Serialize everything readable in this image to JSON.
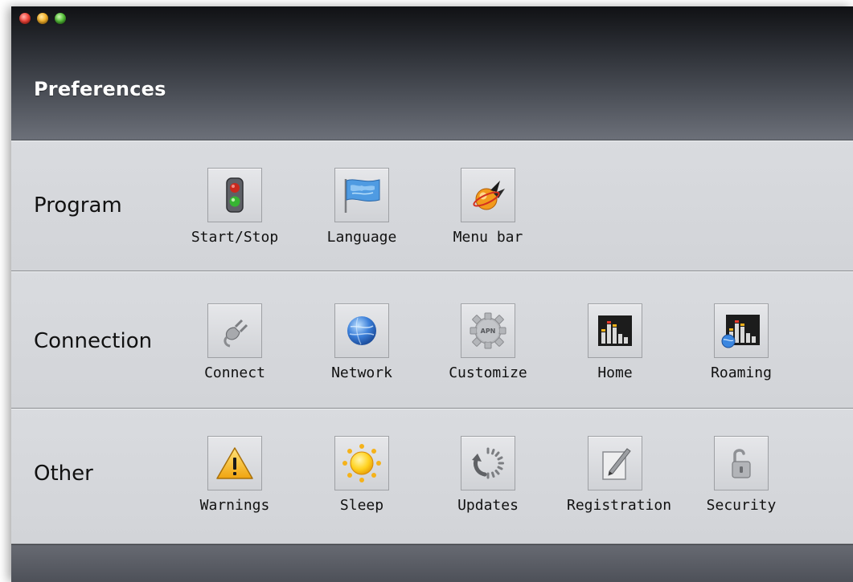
{
  "window": {
    "title": "Preferences"
  },
  "sections": {
    "program": {
      "label": "Program",
      "items": [
        {
          "label": "Start/Stop",
          "icon": "traffic-light-icon"
        },
        {
          "label": "Language",
          "icon": "flag-icon"
        },
        {
          "label": "Menu bar",
          "icon": "menubar-bird-icon"
        }
      ]
    },
    "connection": {
      "label": "Connection",
      "items": [
        {
          "label": "Connect",
          "icon": "plug-icon"
        },
        {
          "label": "Network",
          "icon": "globe-icon"
        },
        {
          "label": "Customize",
          "icon": "apn-gear-icon",
          "icon_text": "APN"
        },
        {
          "label": "Home",
          "icon": "signal-bars-icon"
        },
        {
          "label": "Roaming",
          "icon": "signal-bars-globe-icon"
        }
      ]
    },
    "other": {
      "label": "Other",
      "items": [
        {
          "label": "Warnings",
          "icon": "warning-icon"
        },
        {
          "label": "Sleep",
          "icon": "sun-icon"
        },
        {
          "label": "Updates",
          "icon": "update-arrows-icon"
        },
        {
          "label": "Registration",
          "icon": "pencil-paper-icon"
        },
        {
          "label": "Security",
          "icon": "padlock-icon"
        }
      ]
    }
  },
  "colors": {
    "titlebar_top": "#101114",
    "titlebar_bottom": "#6c7079",
    "section_bg": "#d7d9dd",
    "footer": "#5a5d65",
    "close": "#f34a3f",
    "minimize": "#f5b52f",
    "zoom": "#57c23b"
  }
}
